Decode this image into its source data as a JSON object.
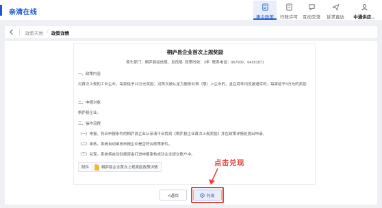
{
  "app": {
    "title": "亲清在线"
  },
  "nav": [
    {
      "label": "惠企政策",
      "icon": "policy-doc-icon",
      "active": true
    },
    {
      "label": "行政许可",
      "icon": "permit-doc-icon",
      "active": false
    },
    {
      "label": "互动交流",
      "icon": "chat-bubble-icon",
      "active": false
    },
    {
      "label": "诉求直达",
      "icon": "send-icon",
      "active": false
    }
  ],
  "user": {
    "name": "中通供应...",
    "icon": "user-icon"
  },
  "breadcrumb": {
    "parent": "政策天地",
    "separator": "/",
    "current": "政策详情"
  },
  "policy": {
    "title": "桐庐县企业首次上规奖励",
    "meta": "牵头部门：桐庐县经信局、发改局    政策时效：3年    联系电话：967000、64291871",
    "sections": [
      "一、政策内容",
      "对首次上规的工业企业，每家给予10万元奖励；对首次被认定为服务业规（限）上企业的，且在两年内没被退库的，每家给予3万元的奖励",
      "二、申报对象",
      "桐庐县企业。",
      "三、操作流程",
      "（一）申报。符合申报条件的桐庐县企业从亲清平台找到《桐庐县企业首次上规奖励》并在政策详情处提出申请。",
      "（二）审核。系统自动审核申报企业是否符合政策条件。",
      "（三）兑现。系统将自动划拨资金打进申报审核成功企业提交账户中。"
    ],
    "attachment_label": "附件",
    "attachment_name": "桐庐县企业首次上规奖励政策详情"
  },
  "buttons": {
    "back": "<返回",
    "redeem": "兑现"
  },
  "annotation": {
    "text": "点击兑现",
    "color": "#e8413a"
  },
  "colors": {
    "accent": "#1f56d6",
    "annotation": "#e8413a"
  }
}
